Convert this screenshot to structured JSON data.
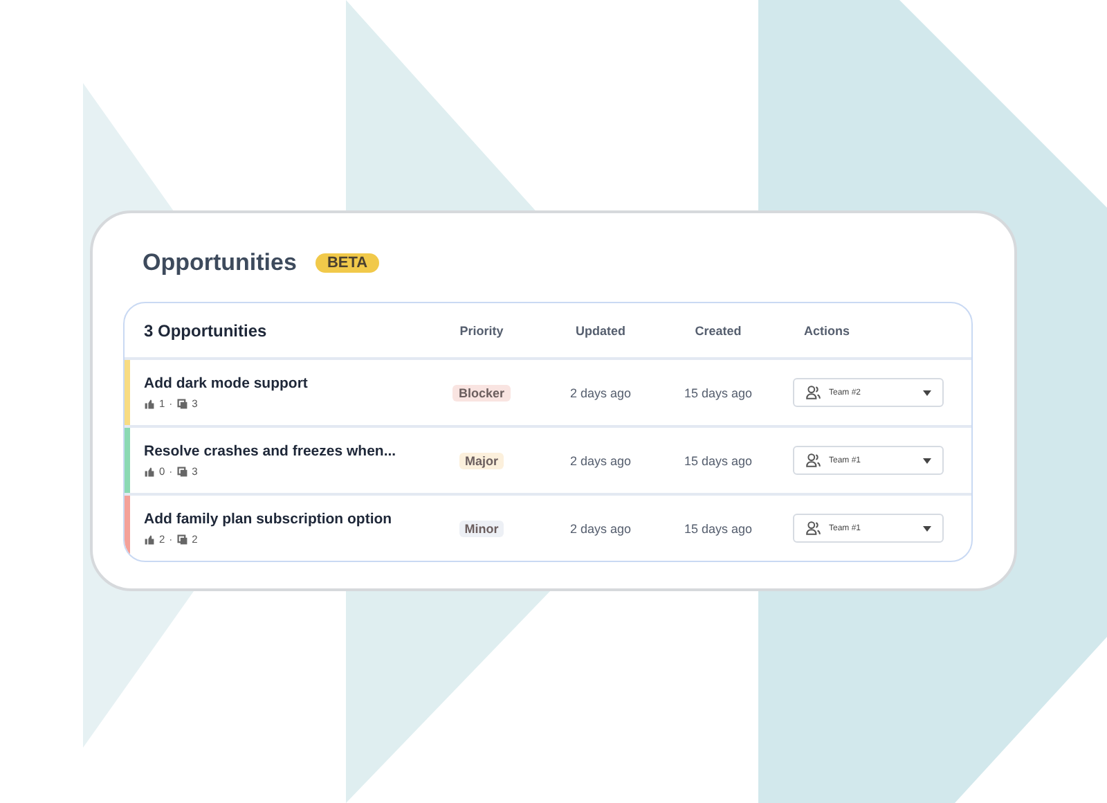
{
  "header": {
    "title": "Opportunities",
    "badge": "BETA"
  },
  "table": {
    "title": "3 Opportunities",
    "columns": [
      "Priority",
      "Updated",
      "Created",
      "Actions"
    ],
    "rows": [
      {
        "title": "Add dark mode support",
        "color": "#f8dc83",
        "votes": "1",
        "separator": "·",
        "links": "3",
        "priority": {
          "label": "Blocker",
          "color": "#f9e4e1"
        },
        "updated": "2 days ago",
        "created": "15 days ago",
        "team": "Team #2"
      },
      {
        "title": "Resolve crashes and freezes when...",
        "color": "#8ad9b3",
        "votes": "0",
        "separator": "·",
        "links": "3",
        "priority": {
          "label": "Major",
          "color": "#fcf0dc"
        },
        "updated": "2 days ago",
        "created": "15 days ago",
        "team": "Team #1"
      },
      {
        "title": "Add family plan subscription option",
        "color": "#f4a199",
        "votes": "2",
        "separator": "·",
        "links": "2",
        "priority": {
          "label": "Minor",
          "color": "#edf0f5"
        },
        "updated": "2 days ago",
        "created": "15 days ago",
        "team": "Team #1"
      }
    ]
  }
}
